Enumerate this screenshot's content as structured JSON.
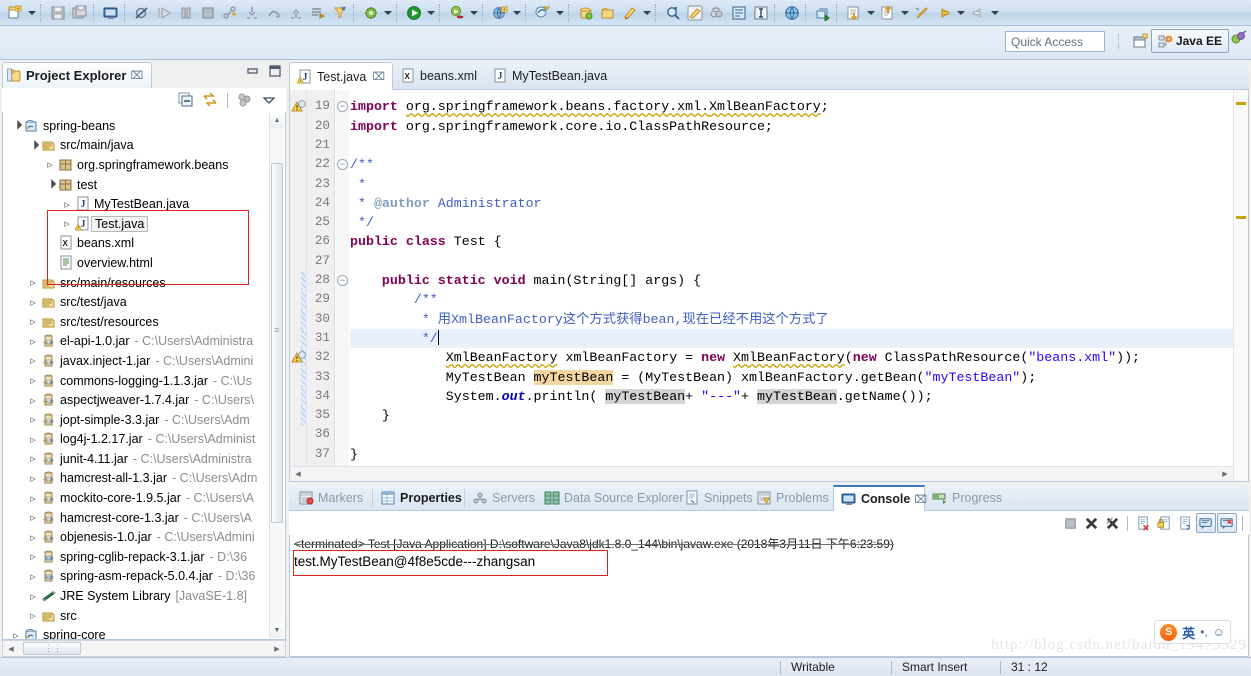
{
  "window": {
    "perspective_label": "Java EE",
    "quick_access_placeholder": "Quick Access",
    "watermark": "http://blog.csdn.net/baidu_19473529"
  },
  "toolbar": {
    "groups": [
      {
        "icons": [
          {
            "name": "new-wizard-icon",
            "glyph": "new"
          },
          {
            "name": "new-dropdown-arrow",
            "glyph": "arrow"
          }
        ]
      },
      {
        "icons": [
          {
            "name": "save-icon",
            "glyph": "save"
          },
          {
            "name": "save-all-icon",
            "glyph": "saveall"
          }
        ]
      },
      {
        "icons": [
          {
            "name": "open-console-icon",
            "glyph": "console"
          }
        ]
      },
      {
        "icons": [
          {
            "name": "skip-breakpoints-icon",
            "glyph": "skipbp"
          },
          {
            "name": "resume-icon",
            "glyph": "resume"
          },
          {
            "name": "suspend-icon",
            "glyph": "suspend"
          },
          {
            "name": "terminate-icon",
            "glyph": "terminate"
          },
          {
            "name": "disconnect-icon",
            "glyph": "disconnect"
          },
          {
            "name": "step-into-icon",
            "glyph": "stepinto"
          },
          {
            "name": "step-over-icon",
            "glyph": "stepover"
          },
          {
            "name": "step-return-icon",
            "glyph": "stepreturn"
          },
          {
            "name": "drop-to-frame-icon",
            "glyph": "droptoframe"
          },
          {
            "name": "use-step-filters-icon",
            "glyph": "stepfilter"
          }
        ]
      },
      {
        "icons": [
          {
            "name": "debug-icon",
            "glyph": "debug"
          },
          {
            "name": "debug-dropdown-arrow",
            "glyph": "arrow"
          }
        ]
      },
      {
        "icons": [
          {
            "name": "run-icon",
            "glyph": "run"
          },
          {
            "name": "run-dropdown-arrow",
            "glyph": "arrow"
          }
        ]
      },
      {
        "icons": [
          {
            "name": "coverage-icon",
            "glyph": "coverage"
          },
          {
            "name": "coverage-dropdown-arrow",
            "glyph": "arrow"
          }
        ]
      },
      {
        "icons": [
          {
            "name": "external-tools-icon",
            "glyph": "exttools"
          },
          {
            "name": "external-tools-dropdown-arrow",
            "glyph": "arrow"
          }
        ]
      },
      {
        "icons": [
          {
            "name": "new-spring-bean-icon",
            "glyph": "springbean"
          },
          {
            "name": "spring-dropdown-arrow",
            "glyph": "arrow"
          }
        ]
      },
      {
        "icons": [
          {
            "name": "open-type-icon",
            "glyph": "opentype"
          },
          {
            "name": "open-task-icon",
            "glyph": "opentask"
          },
          {
            "name": "new-java-package-icon",
            "glyph": "newpkg"
          },
          {
            "name": "package-dropdown-arrow",
            "glyph": "arrow"
          }
        ]
      },
      {
        "icons": [
          {
            "name": "search-icon",
            "glyph": "search"
          },
          {
            "name": "highlight-icon",
            "glyph": "highlight"
          },
          {
            "name": "link-with-editor-icon",
            "glyph": "linkeditor"
          },
          {
            "name": "toggle-block-selection-icon",
            "glyph": "blocksel"
          },
          {
            "name": "show-whitespace-icon",
            "glyph": "whitespace"
          }
        ]
      },
      {
        "icons": [
          {
            "name": "open-web-browser-icon",
            "glyph": "browser"
          }
        ]
      },
      {
        "icons": [
          {
            "name": "open-perspective-icon",
            "glyph": "perspective"
          }
        ]
      },
      {
        "icons": [
          {
            "name": "previous-annotation-icon",
            "glyph": "prevann"
          },
          {
            "name": "previous-annotation-arrow",
            "glyph": "arrow"
          },
          {
            "name": "next-annotation-icon",
            "glyph": "nextann"
          },
          {
            "name": "next-annotation-arrow",
            "glyph": "arrow"
          },
          {
            "name": "last-edit-location-icon",
            "glyph": "lastedit"
          },
          {
            "name": "back-icon",
            "glyph": "back"
          },
          {
            "name": "back-arrow",
            "glyph": "arrow"
          },
          {
            "name": "forward-icon",
            "glyph": "forward"
          },
          {
            "name": "forward-arrow",
            "glyph": "arrow"
          }
        ]
      }
    ]
  },
  "project_explorer": {
    "title": "Project Explorer",
    "close_glyph": "⌧",
    "toolbar": [
      {
        "name": "collapse-all-icon"
      },
      {
        "name": "link-with-editor-icon"
      },
      {
        "name": "filter-icon"
      },
      {
        "name": "view-menu-icon"
      }
    ],
    "tree": [
      {
        "indent": 0,
        "twist": "open",
        "icon": "project",
        "label": "spring-beans",
        "sub": ""
      },
      {
        "indent": 1,
        "twist": "open",
        "icon": "srcfolder",
        "label": "src/main/java",
        "sub": ""
      },
      {
        "indent": 2,
        "twist": "closed",
        "icon": "package",
        "label": "org.springframework.beans",
        "sub": ""
      },
      {
        "indent": 2,
        "twist": "open",
        "icon": "package",
        "label": "test",
        "sub": ""
      },
      {
        "indent": 3,
        "twist": "closed",
        "icon": "javafile",
        "label": "MyTestBean.java",
        "sub": ""
      },
      {
        "indent": 3,
        "twist": "closed",
        "icon": "javafilew",
        "label": "Test.java",
        "sub": "",
        "selected": true
      },
      {
        "indent": 2,
        "twist": "none",
        "icon": "xmlfile",
        "label": "beans.xml",
        "sub": ""
      },
      {
        "indent": 2,
        "twist": "none",
        "icon": "htmlfile",
        "label": "overview.html",
        "sub": ""
      },
      {
        "indent": 1,
        "twist": "closed",
        "icon": "folder",
        "label": "src/main/resources",
        "sub": ""
      },
      {
        "indent": 1,
        "twist": "closed",
        "icon": "srcfolder",
        "label": "src/test/java",
        "sub": ""
      },
      {
        "indent": 1,
        "twist": "closed",
        "icon": "folder",
        "label": "src/test/resources",
        "sub": ""
      },
      {
        "indent": 1,
        "twist": "closed",
        "icon": "jar",
        "label": "el-api-1.0.jar",
        "sub": "- C:\\Users\\Administra"
      },
      {
        "indent": 1,
        "twist": "closed",
        "icon": "jar",
        "label": "javax.inject-1.jar",
        "sub": "- C:\\Users\\Admini"
      },
      {
        "indent": 1,
        "twist": "closed",
        "icon": "jar",
        "label": "commons-logging-1.1.3.jar",
        "sub": "- C:\\Us"
      },
      {
        "indent": 1,
        "twist": "closed",
        "icon": "jar",
        "label": "aspectjweaver-1.7.4.jar",
        "sub": "- C:\\Users\\"
      },
      {
        "indent": 1,
        "twist": "closed",
        "icon": "jar",
        "label": "jopt-simple-3.3.jar",
        "sub": "- C:\\Users\\Adm"
      },
      {
        "indent": 1,
        "twist": "closed",
        "icon": "jar",
        "label": "log4j-1.2.17.jar",
        "sub": "- C:\\Users\\Administ"
      },
      {
        "indent": 1,
        "twist": "closed",
        "icon": "jar",
        "label": "junit-4.11.jar",
        "sub": "- C:\\Users\\Administra"
      },
      {
        "indent": 1,
        "twist": "closed",
        "icon": "jar",
        "label": "hamcrest-all-1.3.jar",
        "sub": "- C:\\Users\\Adm"
      },
      {
        "indent": 1,
        "twist": "closed",
        "icon": "jar",
        "label": "mockito-core-1.9.5.jar",
        "sub": "- C:\\Users\\A"
      },
      {
        "indent": 1,
        "twist": "closed",
        "icon": "jar",
        "label": "hamcrest-core-1.3.jar",
        "sub": "- C:\\Users\\A"
      },
      {
        "indent": 1,
        "twist": "closed",
        "icon": "jar",
        "label": "objenesis-1.0.jar",
        "sub": "- C:\\Users\\Admini"
      },
      {
        "indent": 1,
        "twist": "closed",
        "icon": "jar2",
        "label": "spring-cglib-repack-3.1.jar",
        "sub": "- D:\\36"
      },
      {
        "indent": 1,
        "twist": "closed",
        "icon": "jar2",
        "label": "spring-asm-repack-5.0.4.jar",
        "sub": "- D:\\36"
      },
      {
        "indent": 1,
        "twist": "closed",
        "icon": "library",
        "label": "JRE System Library",
        "sub": "[JavaSE-1.8]"
      },
      {
        "indent": 1,
        "twist": "closed",
        "icon": "srcfolder",
        "label": "src",
        "sub": ""
      },
      {
        "indent": 0,
        "twist": "closed",
        "icon": "project",
        "label": "spring-core",
        "sub": ""
      }
    ]
  },
  "editor": {
    "tabs": [
      {
        "label": "Test.java",
        "icon": "javafilew",
        "active": true,
        "close": "⌧"
      },
      {
        "label": "beans.xml",
        "icon": "xmlfile",
        "active": false,
        "close": ""
      },
      {
        "label": "MyTestBean.java",
        "icon": "javafile",
        "active": false,
        "close": ""
      }
    ],
    "first_visible_line": 18,
    "lines": [
      {
        "no": "18",
        "partial": true,
        "text": ""
      },
      {
        "no": "19",
        "fold": "-",
        "warn": true,
        "tokens": [
          {
            "t": "import ",
            "c": "kw"
          },
          {
            "t": "org.springframework.beans.factory.xml.",
            "c": "warnunder"
          },
          {
            "t": "XmlBeanFactory",
            "c": "warnunder dep"
          },
          {
            "t": ";",
            "c": ""
          }
        ]
      },
      {
        "no": "20",
        "tokens": [
          {
            "t": "import ",
            "c": "kw"
          },
          {
            "t": "org.springframework.core.io.ClassPathResource;",
            "c": ""
          }
        ]
      },
      {
        "no": "21",
        "tokens": []
      },
      {
        "no": "22",
        "fold": "-",
        "tokens": [
          {
            "t": "/**",
            "c": "jdoc"
          }
        ]
      },
      {
        "no": "23",
        "tokens": [
          {
            "t": " *",
            "c": "jdoc"
          }
        ]
      },
      {
        "no": "24",
        "tokens": [
          {
            "t": " * ",
            "c": "jdoc"
          },
          {
            "t": "@author",
            "c": "jtag"
          },
          {
            "t": " Administrator",
            "c": "jdoc"
          }
        ]
      },
      {
        "no": "25",
        "tokens": [
          {
            "t": " */",
            "c": "jdoc"
          }
        ]
      },
      {
        "no": "26",
        "tokens": [
          {
            "t": "public class ",
            "c": "kw"
          },
          {
            "t": "Test {",
            "c": ""
          }
        ]
      },
      {
        "no": "27",
        "tokens": []
      },
      {
        "no": "28",
        "fold": "-",
        "sel": true,
        "tokens": [
          {
            "t": "    ",
            "c": ""
          },
          {
            "t": "public static void ",
            "c": "kw"
          },
          {
            "t": "main(String[] args) {",
            "c": ""
          }
        ]
      },
      {
        "no": "29",
        "sel": true,
        "tokens": [
          {
            "t": "        ",
            "c": ""
          },
          {
            "t": "/**",
            "c": "jdoc"
          }
        ]
      },
      {
        "no": "30",
        "sel": true,
        "tokens": [
          {
            "t": "         * ",
            "c": "jdoc"
          },
          {
            "t": "用XmlBeanFactory这个方式获得bean,现在已经不用这个方式了",
            "c": "jdoc"
          }
        ]
      },
      {
        "no": "31",
        "sel": true,
        "current": true,
        "tokens": [
          {
            "t": "         */",
            "c": "jdoc"
          }
        ],
        "caret": true
      },
      {
        "no": "32",
        "sel": true,
        "warn": true,
        "tokens": [
          {
            "t": "            ",
            "c": ""
          },
          {
            "t": "XmlBeanFactory",
            "c": "dep warnunder"
          },
          {
            "t": " xmlBeanFactory = ",
            "c": ""
          },
          {
            "t": "new ",
            "c": "kw"
          },
          {
            "t": "XmlBeanFactory",
            "c": "dep warnunder"
          },
          {
            "t": "(",
            "c": ""
          },
          {
            "t": "new ",
            "c": "kw"
          },
          {
            "t": "ClassPathResource(",
            "c": ""
          },
          {
            "t": "\"beans.xml\"",
            "c": "str"
          },
          {
            "t": "));",
            "c": ""
          }
        ]
      },
      {
        "no": "33",
        "sel": true,
        "tokens": [
          {
            "t": "            MyTestBean ",
            "c": ""
          },
          {
            "t": "myTestBean",
            "c": "hl-write"
          },
          {
            "t": " = (MyTestBean) xmlBeanFactory.getBean(",
            "c": ""
          },
          {
            "t": "\"myTestBean\"",
            "c": "str"
          },
          {
            "t": ");",
            "c": ""
          }
        ]
      },
      {
        "no": "34",
        "sel": true,
        "tokens": [
          {
            "t": "            System.",
            "c": ""
          },
          {
            "t": "out",
            "c": "fld"
          },
          {
            "t": ".println( ",
            "c": ""
          },
          {
            "t": "myTestBean",
            "c": "hl-occ"
          },
          {
            "t": "+ ",
            "c": ""
          },
          {
            "t": "\"---\"",
            "c": "str"
          },
          {
            "t": "+ ",
            "c": ""
          },
          {
            "t": "myTestBean",
            "c": "hl-occ"
          },
          {
            "t": ".getName());",
            "c": ""
          }
        ]
      },
      {
        "no": "35",
        "sel": true,
        "tokens": [
          {
            "t": "    }",
            "c": ""
          }
        ]
      },
      {
        "no": "36",
        "tokens": []
      },
      {
        "no": "37",
        "tokens": [
          {
            "t": "}",
            "c": ""
          }
        ]
      }
    ]
  },
  "console": {
    "tabs": [
      {
        "label": "Markers",
        "icon": "markers",
        "state": "normal"
      },
      {
        "label": "Properties",
        "icon": "props",
        "state": "bold"
      },
      {
        "label": "Servers",
        "icon": "servers",
        "state": "normal"
      },
      {
        "label": "Data Source Explorer",
        "icon": "datasrc",
        "state": "normal"
      },
      {
        "label": "Snippets",
        "icon": "snippets",
        "state": "normal"
      },
      {
        "label": "Problems",
        "icon": "problems",
        "state": "normal"
      },
      {
        "label": "Console",
        "icon": "console",
        "state": "active",
        "close": "⌧"
      },
      {
        "label": "Progress",
        "icon": "progress",
        "state": "normal"
      }
    ],
    "toolbar": [
      {
        "name": "terminate-icon"
      },
      {
        "name": "remove-launch-icon"
      },
      {
        "name": "remove-all-terminated-icon"
      },
      {
        "name": "clear-console-icon"
      },
      {
        "name": "scroll-lock-icon"
      },
      {
        "name": "word-wrap-icon"
      },
      {
        "name": "display-selected-console-icon",
        "boxed": true
      },
      {
        "name": "open-console-icon",
        "boxed": true
      }
    ],
    "header": "<terminated> Test [Java Application] D:\\software\\Java8\\jdk1.8.0_144\\bin\\javaw.exe (2018年3月11日 下午6:23:59)",
    "output": "test.MyTestBean@4f8e5cde---zhangsan"
  },
  "statusbar": {
    "writable": "Writable",
    "insert_mode": "Smart Insert",
    "position": "31 : 12"
  },
  "ime": {
    "logo": "S",
    "mode": "英",
    "punct": "•,",
    "face": "☺"
  }
}
